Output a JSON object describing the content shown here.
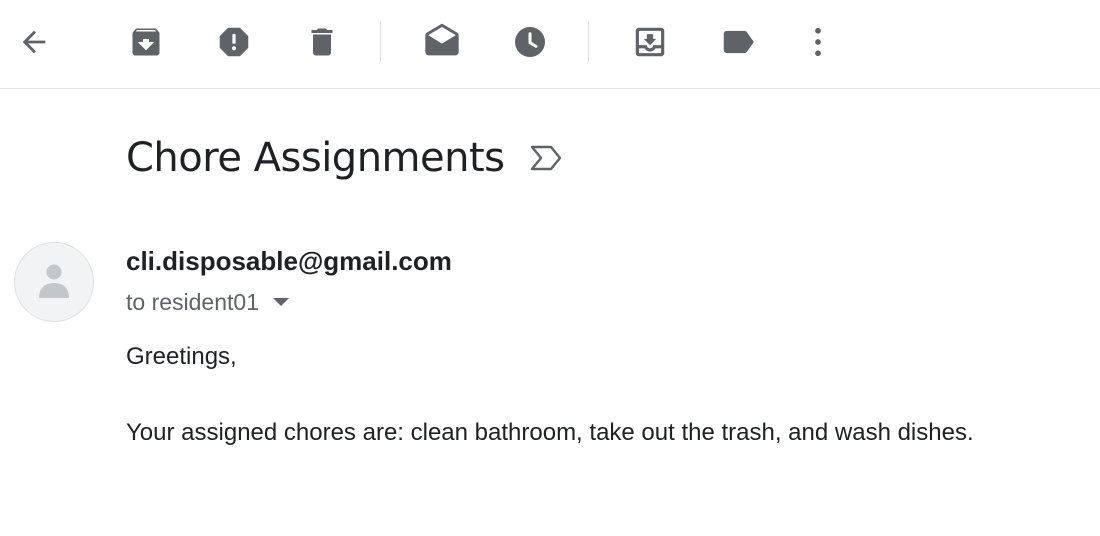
{
  "toolbar": {
    "buttons": [
      {
        "name": "back",
        "icon": "arrow-left-icon"
      },
      {
        "name": "archive",
        "icon": "archive-icon"
      },
      {
        "name": "report-spam",
        "icon": "report-spam-icon"
      },
      {
        "name": "delete",
        "icon": "trash-icon"
      },
      {
        "name": "mark-unread",
        "icon": "mark-unread-icon"
      },
      {
        "name": "snooze",
        "icon": "clock-icon"
      },
      {
        "name": "move-to",
        "icon": "move-to-inbox-icon"
      },
      {
        "name": "labels",
        "icon": "label-icon"
      },
      {
        "name": "more",
        "icon": "more-vertical-icon"
      }
    ],
    "icon_color": "#5f6368"
  },
  "email": {
    "subject": "Chore Assignments",
    "important_marker_icon": "important-marker-icon",
    "sender": "cli.disposable@gmail.com",
    "recipient": "to resident01",
    "avatar_icon": "default-avatar-icon",
    "body": {
      "greeting": "Greetings,",
      "message": "Your assigned chores are: clean bathroom, take out the trash, and wash dishes."
    }
  }
}
